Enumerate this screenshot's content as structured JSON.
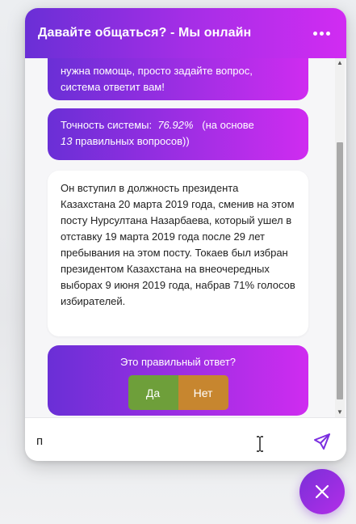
{
  "header": {
    "title": "Давайте общаться? - Мы онлайн",
    "menu_icon": "more-horizontal-icon"
  },
  "messages": {
    "partial_intro": {
      "line1": "нужна помощь, просто задайте вопрос,",
      "line2": "система ответит вам!"
    },
    "accuracy": {
      "label": "Точность системы:",
      "value": "76.92%",
      "note_open": "(на основе",
      "count": "13",
      "note_close": "правильных вопросов))"
    },
    "answer": {
      "text": "Он вступил в должность президента Казахстана 20 марта 2019 года, сменив на этом посту Нурсултана Назарбаева, который ушел в отставку 19 марта 2019 года после 29 лет пребывания на этом посту. Токаев был избран президентом Казахстана на внеочередных выборах 9 июня 2019 года, набрав 71% голосов избирателей."
    },
    "feedback": {
      "question": "Это правильный ответ?",
      "yes_label": "Да",
      "no_label": "Нет"
    }
  },
  "input": {
    "value": "п",
    "send_icon": "send-icon"
  },
  "fab": {
    "icon": "close-icon"
  },
  "colors": {
    "header_gradient_start": "#6a2fd6",
    "header_gradient_end": "#d12cf2",
    "yes_button": "#6e9f3a",
    "no_button": "#c7862f"
  }
}
